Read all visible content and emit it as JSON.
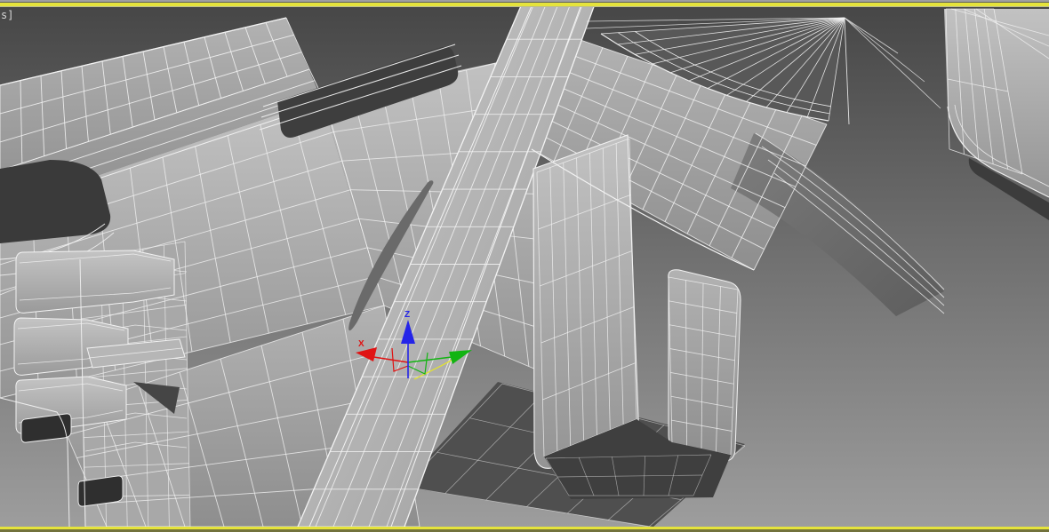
{
  "viewport": {
    "label_text": "s]",
    "active_border_color": "#e5e33b",
    "background_gradient_top": "#474747",
    "background_gradient_bottom": "#9d9d9d",
    "wireframe_edge_color": "#f2f2f2",
    "content_description": "shaded wireframe mesh of a mechanical part"
  },
  "gizmo": {
    "labels": {
      "x": "X",
      "z": "Z"
    },
    "colors": {
      "x": "#e01313",
      "y": "#12b412",
      "z": "#2424e8",
      "plane": "#e8e824"
    }
  }
}
